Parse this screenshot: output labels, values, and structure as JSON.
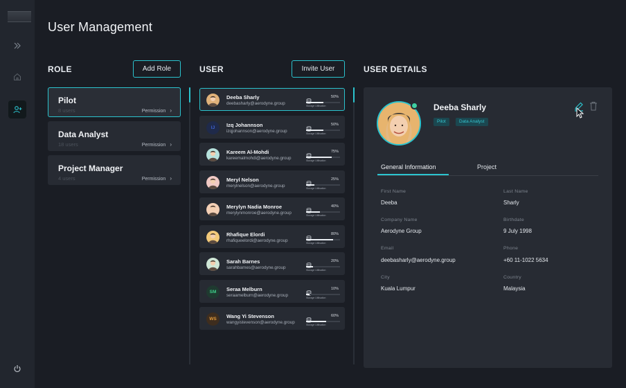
{
  "app": {
    "title": "User Management"
  },
  "colors": {
    "accent": "#2bc4cf",
    "background": "#1a1d24",
    "panel": "#272b33",
    "online": "#3ed0a2"
  },
  "sidebar": {
    "items": [
      {
        "icon": "chevrons-right-icon"
      },
      {
        "icon": "home-icon"
      },
      {
        "icon": "user-plus-icon",
        "active": true
      },
      {
        "icon": "power-icon"
      }
    ]
  },
  "roles": {
    "heading": "ROLE",
    "add_label": "Add Role",
    "items": [
      {
        "name": "Pilot",
        "count": "8 users",
        "permission": "Permission",
        "selected": true
      },
      {
        "name": "Data Analyst",
        "count": "18 users",
        "permission": "Permission"
      },
      {
        "name": "Project Manager",
        "count": "4 users",
        "permission": "Permission"
      }
    ]
  },
  "users": {
    "heading": "USER",
    "invite_label": "Invite User",
    "storage_caption": "Storage Utilisation",
    "items": [
      {
        "name": "Deeba Sharly",
        "email": "deebasharly@aerodyne.group",
        "percent": "50%",
        "fill": 0.5,
        "initials": "",
        "avatar_color": "#e0b27a",
        "selected": true
      },
      {
        "name": "Izq Johannson",
        "email": "izqjohannson@aerodyne.group",
        "percent": "50%",
        "fill": 0.5,
        "initials": "IJ",
        "avatar_color": "#1f2a4a",
        "initials_color": "#3f63d6"
      },
      {
        "name": "Kareem Al-Mohdi",
        "email": "kareemalmohdi@aerodyne.group",
        "percent": "75%",
        "fill": 0.75,
        "initials": "",
        "avatar_color": "#b7e2dd"
      },
      {
        "name": "Meryl Nelson",
        "email": "merylnelson@aerodyne.group",
        "percent": "25%",
        "fill": 0.25,
        "initials": "",
        "avatar_color": "#f0c9c4"
      },
      {
        "name": "Merylyn Nadia Monroe",
        "email": "merylynmonroe@aerodyne.group",
        "percent": "40%",
        "fill": 0.4,
        "initials": "",
        "avatar_color": "#f4d0b6"
      },
      {
        "name": "Rhafique Elordi",
        "email": "rhafiqueelordi@aerodyne.group",
        "percent": "80%",
        "fill": 0.8,
        "initials": "",
        "avatar_color": "#f2c97a"
      },
      {
        "name": "Sarah Barnes",
        "email": "sarahbarnes@aerodyne.group",
        "percent": "20%",
        "fill": 0.2,
        "initials": "",
        "avatar_color": "#cfe6d6"
      },
      {
        "name": "Seraa Melburn",
        "email": "seraamelburn@aerodyne.group",
        "percent": "10%",
        "fill": 0.1,
        "initials": "SM",
        "avatar_color": "#1f3a30",
        "initials_color": "#3ed08a"
      },
      {
        "name": "Wang Yi Stevenson",
        "email": "wangyistevenson@aerodyne.group",
        "percent": "60%",
        "fill": 0.6,
        "initials": "WS",
        "avatar_color": "#3e2d1e",
        "initials_color": "#e39a3a"
      }
    ]
  },
  "details": {
    "heading": "USER DETAILS",
    "name": "Deeba Sharly",
    "tags": [
      "Pilot",
      "Data Analyst"
    ],
    "tabs": [
      "General Information",
      "Project"
    ],
    "fields": [
      {
        "label": "First Name",
        "value": "Deeba"
      },
      {
        "label": "Last Name",
        "value": "Sharly"
      },
      {
        "label": "Company Name",
        "value": "Aerodyne Group"
      },
      {
        "label": "Birthdate",
        "value": "9 July 1998"
      },
      {
        "label": "Email",
        "value": "deebasharly@aerodyne.group"
      },
      {
        "label": "Phone",
        "value": "+60 11-1022 5634"
      },
      {
        "label": "City",
        "value": "Kuala Lumpur"
      },
      {
        "label": "Country",
        "value": "Malaysia"
      }
    ]
  }
}
